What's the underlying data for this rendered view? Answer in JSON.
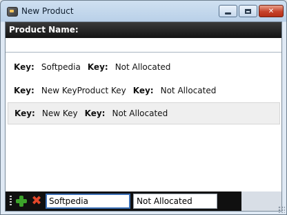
{
  "window": {
    "title": "New Product",
    "minimize_icon": "minimize-icon",
    "maximize_icon": "maximize-icon",
    "close_icon": "close-icon",
    "close_glyph": "✕"
  },
  "header": {
    "label": "Product Name:"
  },
  "product_name": {
    "value": ""
  },
  "rows": [
    {
      "k1": "Key:",
      "v1": "Softpedia",
      "k2": "Key:",
      "v2": "Not Allocated"
    },
    {
      "k1": "Key:",
      "v1": "New KeyProduct Key",
      "k2": "Key:",
      "v2": "Not Allocated"
    },
    {
      "k1": "Key:",
      "v1": "New Key",
      "k2": "Key:",
      "v2": "Not Allocated"
    }
  ],
  "editor": {
    "add_icon": "add-icon",
    "remove_icon": "remove-icon",
    "remove_glyph": "✖",
    "name_value": "Softpedia",
    "key_value": "Not Allocated"
  },
  "colors": {
    "header_bar": "#1c1c1c",
    "selection": "#efefef",
    "add_green": "#3ca22a",
    "remove_red": "#e3472a",
    "close_red": "#c6422a"
  }
}
